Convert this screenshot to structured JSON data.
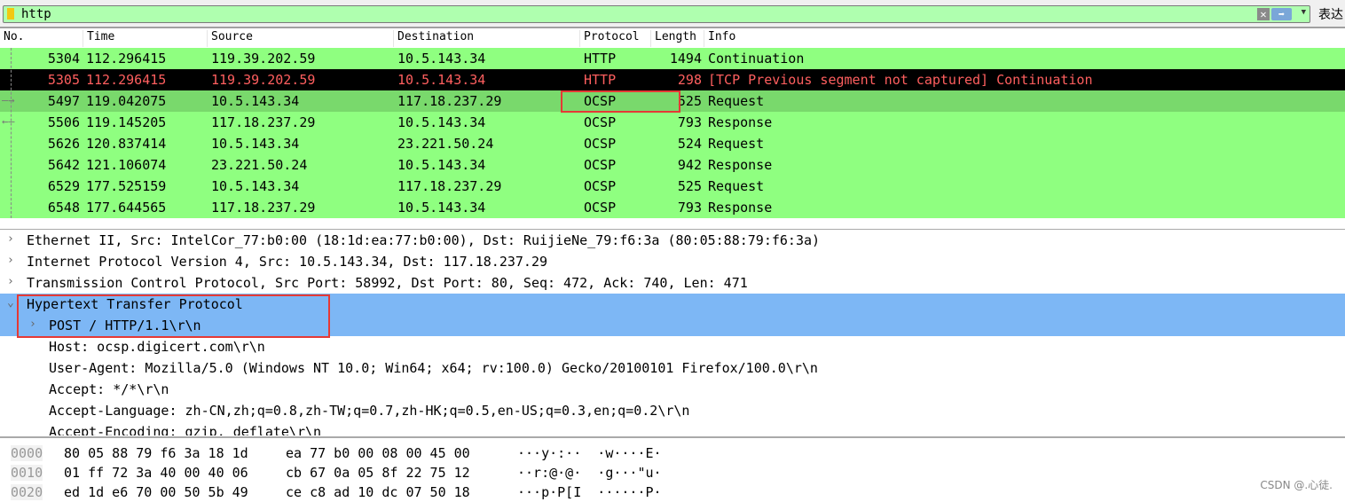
{
  "filter": {
    "value": "http",
    "expression_label": "表达"
  },
  "columns": [
    "No.",
    "Time",
    "Source",
    "Destination",
    "Protocol",
    "Length",
    "Info"
  ],
  "packets": [
    {
      "no": "5304",
      "time": "112.296415",
      "src": "119.39.202.59",
      "dst": "10.5.143.34",
      "proto": "HTTP",
      "len": "1494",
      "info": "Continuation"
    },
    {
      "no": "5305",
      "time": "112.296415",
      "src": "119.39.202.59",
      "dst": "10.5.143.34",
      "proto": "HTTP",
      "len": "298",
      "info": "[TCP Previous segment not captured] Continuation"
    },
    {
      "no": "5497",
      "time": "119.042075",
      "src": "10.5.143.34",
      "dst": "117.18.237.29",
      "proto": "OCSP",
      "len": "525",
      "info": "Request"
    },
    {
      "no": "5506",
      "time": "119.145205",
      "src": "117.18.237.29",
      "dst": "10.5.143.34",
      "proto": "OCSP",
      "len": "793",
      "info": "Response"
    },
    {
      "no": "5626",
      "time": "120.837414",
      "src": "10.5.143.34",
      "dst": "23.221.50.24",
      "proto": "OCSP",
      "len": "524",
      "info": "Request"
    },
    {
      "no": "5642",
      "time": "121.106074",
      "src": "23.221.50.24",
      "dst": "10.5.143.34",
      "proto": "OCSP",
      "len": "942",
      "info": "Response"
    },
    {
      "no": "6529",
      "time": "177.525159",
      "src": "10.5.143.34",
      "dst": "117.18.237.29",
      "proto": "OCSP",
      "len": "525",
      "info": "Request"
    },
    {
      "no": "6548",
      "time": "177.644565",
      "src": "117.18.237.29",
      "dst": "10.5.143.34",
      "proto": "OCSP",
      "len": "793",
      "info": "Response"
    }
  ],
  "details": [
    "Ethernet II, Src: IntelCor_77:b0:00 (18:1d:ea:77:b0:00), Dst: RuijieNe_79:f6:3a (80:05:88:79:f6:3a)",
    "Internet Protocol Version 4, Src: 10.5.143.34, Dst: 117.18.237.29",
    "Transmission Control Protocol, Src Port: 58992, Dst Port: 80, Seq: 472, Ack: 740, Len: 471",
    "Hypertext Transfer Protocol",
    "POST / HTTP/1.1\\r\\n",
    "Host: ocsp.digicert.com\\r\\n",
    "User-Agent: Mozilla/5.0 (Windows NT 10.0; Win64; x64; rv:100.0) Gecko/20100101 Firefox/100.0\\r\\n",
    "Accept: */*\\r\\n",
    "Accept-Language: zh-CN,zh;q=0.8,zh-TW;q=0.7,zh-HK;q=0.5,en-US;q=0.3,en;q=0.2\\r\\n",
    "Accept-Encoding: gzip, deflate\\r\\n"
  ],
  "hex": [
    {
      "off": "0000",
      "a": "80 05 88 79 f6 3a 18 1d",
      "b": "ea 77 b0 00 08 00 45 00",
      "ascii": "···y·:··  ·w····E·"
    },
    {
      "off": "0010",
      "a": "01 ff 72 3a 40 00 40 06",
      "b": "cb 67 0a 05 8f 22 75 12",
      "ascii": "··r:@·@·  ·g···\"u·"
    },
    {
      "off": "0020",
      "a": "ed 1d e6 70 00 50 5b 49",
      "b": "ce c8 ad 10 dc 07 50 18",
      "ascii": "···p·P[I  ······P·"
    }
  ],
  "watermark": "CSDN @.心徒."
}
